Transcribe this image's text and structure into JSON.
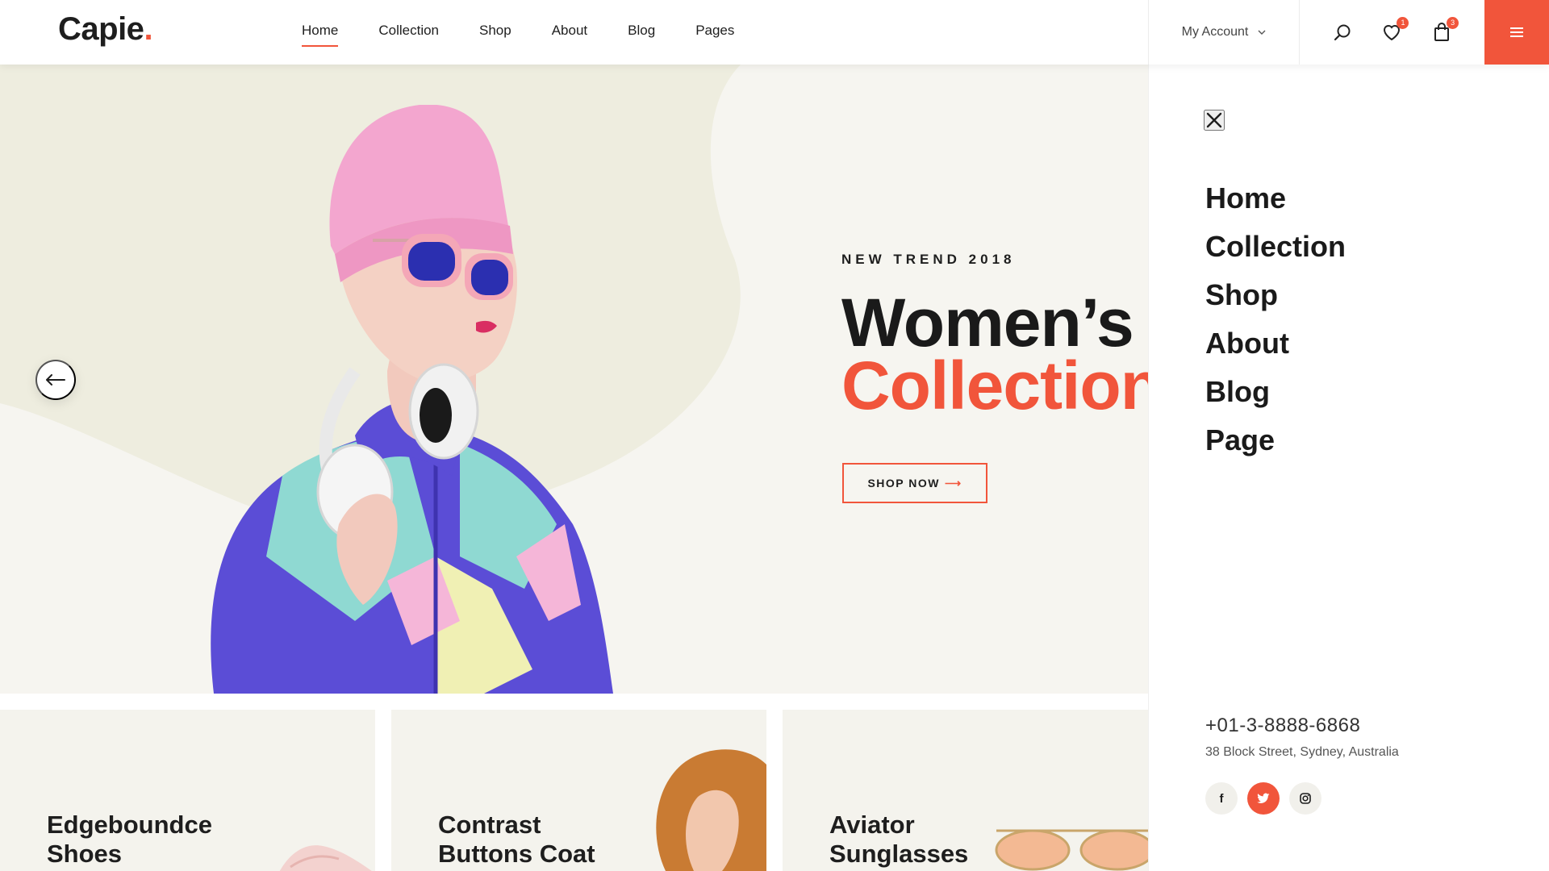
{
  "header": {
    "logo": "Capie",
    "logo_dot": ".",
    "nav": [
      {
        "label": "Home",
        "active": true
      },
      {
        "label": "Collection"
      },
      {
        "label": "Shop"
      },
      {
        "label": "About"
      },
      {
        "label": "Blog"
      },
      {
        "label": "Pages"
      }
    ],
    "account_label": "My Account",
    "wishlist_count": "1",
    "cart_count": "3",
    "icons": [
      "search-icon",
      "heart-icon",
      "shopping-bag-icon",
      "hamburger-menu-icon",
      "chevron-down-icon"
    ]
  },
  "hero": {
    "kicker": "NEW TREND 2018",
    "title_line1": "Women’s",
    "title_line2": "Collection",
    "cta_label": "SHOP NOW",
    "cta_arrow": "⟶",
    "prev_icon": "arrow-left-icon"
  },
  "cards": [
    {
      "title": "Edgeboundce Shoes"
    },
    {
      "title": "Contrast Buttons Coat"
    },
    {
      "title": "Aviator Sunglasses"
    }
  ],
  "side_panel": {
    "menu": [
      "Home",
      "Collection",
      "Shop",
      "About",
      "Blog",
      "Page"
    ],
    "phone": "+01-3-8888-6868",
    "address": "38 Block Street, Sydney, Australia",
    "socials": [
      {
        "icon": "facebook-icon",
        "glyph": "f",
        "active": false
      },
      {
        "icon": "twitter-icon",
        "glyph": "t",
        "active": true
      },
      {
        "icon": "instagram-icon",
        "glyph": "◎",
        "active": false
      }
    ]
  },
  "colors": {
    "accent": "#f1553b",
    "hero_bg": "#f6f5f0",
    "text_dark": "#1a1a1a"
  }
}
